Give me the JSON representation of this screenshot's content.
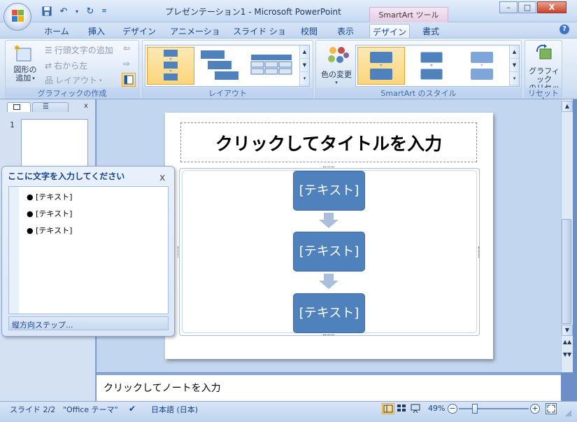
{
  "window": {
    "title": "プレゼンテーション1 - Microsoft PowerPoint",
    "context_tab_title": "SmartArt ツール",
    "minimize": "–",
    "maximize": "□",
    "close": "X"
  },
  "tabs": [
    {
      "label": "ホーム"
    },
    {
      "label": "挿入"
    },
    {
      "label": "デザイン"
    },
    {
      "label": "アニメーション"
    },
    {
      "label": "スライド ショー"
    },
    {
      "label": "校閲"
    },
    {
      "label": "表示"
    },
    {
      "label": "デザイン",
      "active": true
    },
    {
      "label": "書式"
    }
  ],
  "help_label": "?",
  "ribbon": {
    "create_graphic": {
      "label": "グラフィックの作成",
      "add_shape_line1": "図形の",
      "add_shape_line2": "追加",
      "add_bullet": "行頭文字の追加",
      "right_to_left": "右から左",
      "layout": "レイアウト"
    },
    "layouts": {
      "label": "レイアウト"
    },
    "styles": {
      "label": "SmartArt のスタイル",
      "change_colors": "色の変更"
    },
    "reset": {
      "label": "リセット",
      "reset_graphic_line1": "グラフィック",
      "reset_graphic_line2": "のリセット"
    }
  },
  "slides_pane": {
    "slide_number": "1"
  },
  "slide": {
    "title_placeholder": "クリックしてタイトルを入力",
    "smartart_boxes": [
      "[テキスト]",
      "[テキスト]",
      "[テキスト]"
    ]
  },
  "text_pane": {
    "title": "ここに文字を入力してください",
    "close": "x",
    "bullets": [
      "[テキスト]",
      "[テキスト]",
      "[テキスト]"
    ],
    "footer": "縦方向ステップ..."
  },
  "notes": {
    "placeholder": "クリックしてノートを入力"
  },
  "status": {
    "slide": "スライド 2/2",
    "theme": "\"Office テーマ\"",
    "language": "日本語 (日本)",
    "zoom": "49%"
  },
  "colors": {
    "accent": "#4f81bd",
    "selection": "#fbd57a"
  }
}
